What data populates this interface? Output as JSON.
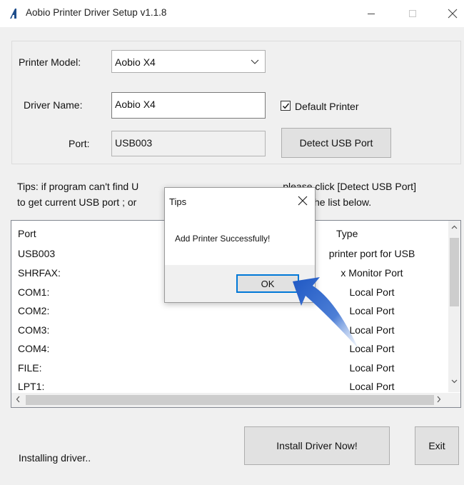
{
  "window": {
    "title": "Aobio Printer Driver Setup v1.1.8"
  },
  "form": {
    "printer_model_label": "Printer Model:",
    "printer_model_value": "Aobio X4",
    "driver_name_label": "Driver Name:",
    "driver_name_value": "Aobio X4",
    "default_printer_label": "Default Printer",
    "default_printer_checked": true,
    "port_label": "Port:",
    "port_value": "USB003",
    "detect_button": "Detect USB Port"
  },
  "tips": {
    "line1_prefix": "Tips: if program can't find U",
    "line1_suffix": "please click [Detect USB Port]",
    "line2_prefix": "to get current USB port ; or",
    "line2_suffix": "in the list below."
  },
  "port_list": {
    "columns": [
      "Port",
      "Type"
    ],
    "rows": [
      {
        "port": "USB003",
        "type": "printer port for USB"
      },
      {
        "port": "SHRFAX:",
        "type": "x Monitor Port"
      },
      {
        "port": "COM1:",
        "type": "Local Port"
      },
      {
        "port": "COM2:",
        "type": "Local Port"
      },
      {
        "port": "COM3:",
        "type": "Local Port"
      },
      {
        "port": "COM4:",
        "type": "Local Port"
      },
      {
        "port": "FILE:",
        "type": "Local Port"
      },
      {
        "port": "LPT1:",
        "type": "Local Port"
      }
    ]
  },
  "footer": {
    "status_text": "Installing driver..",
    "install_button": "Install Driver Now!",
    "exit_button": "Exit"
  },
  "dialog": {
    "title": "Tips",
    "message": "Add Printer Successfully!",
    "ok_button": "OK"
  },
  "colors": {
    "window_bg": "#f0f0f0",
    "accent": "#0078d7",
    "pointer_arrow": "#2f63c0"
  }
}
